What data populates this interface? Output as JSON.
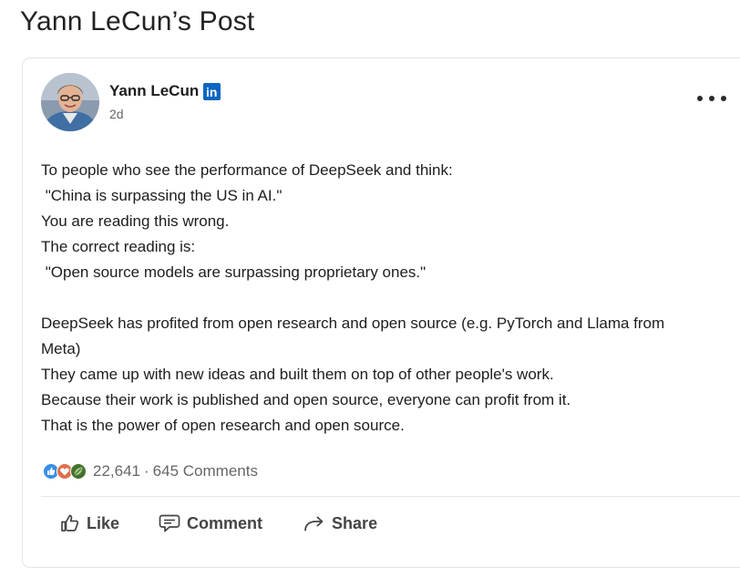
{
  "page": {
    "title": "Yann LeCun’s Post"
  },
  "post": {
    "author": {
      "name": "Yann LeCun",
      "badge_icon": "linkedin-icon",
      "badge_text": "in",
      "badge_color": "#0a66c2",
      "avatar_icon": "profile-photo"
    },
    "timestamp": "2d",
    "more_icon": "more-options-icon",
    "body_lines": [
      "To people who see the performance of DeepSeek and think:",
      " \"China is surpassing the US in AI.\"",
      "You are reading this wrong.",
      "The correct reading is:",
      " \"Open source models are surpassing proprietary ones.\"",
      "",
      "DeepSeek has profited from open research and open source (e.g. PyTorch and Llama from",
      "Meta)",
      "They came up with new ideas and built them on top of other people's work.",
      "Because their work is published and open source, everyone can profit from it.",
      "That is the power of open research and open source."
    ],
    "reactions": {
      "icons": [
        "like-reaction-icon",
        "love-reaction-icon",
        "insightful-reaction-icon"
      ],
      "colors": {
        "like": "#378fe9",
        "love": "#df704d",
        "insightful": "#44712e"
      },
      "count": "22,641",
      "separator": "·",
      "comments": "645 Comments"
    },
    "actions": [
      {
        "label": "Like",
        "icon": "thumbs-up-icon"
      },
      {
        "label": "Comment",
        "icon": "comment-icon"
      },
      {
        "label": "Share",
        "icon": "share-arrow-icon"
      }
    ]
  }
}
